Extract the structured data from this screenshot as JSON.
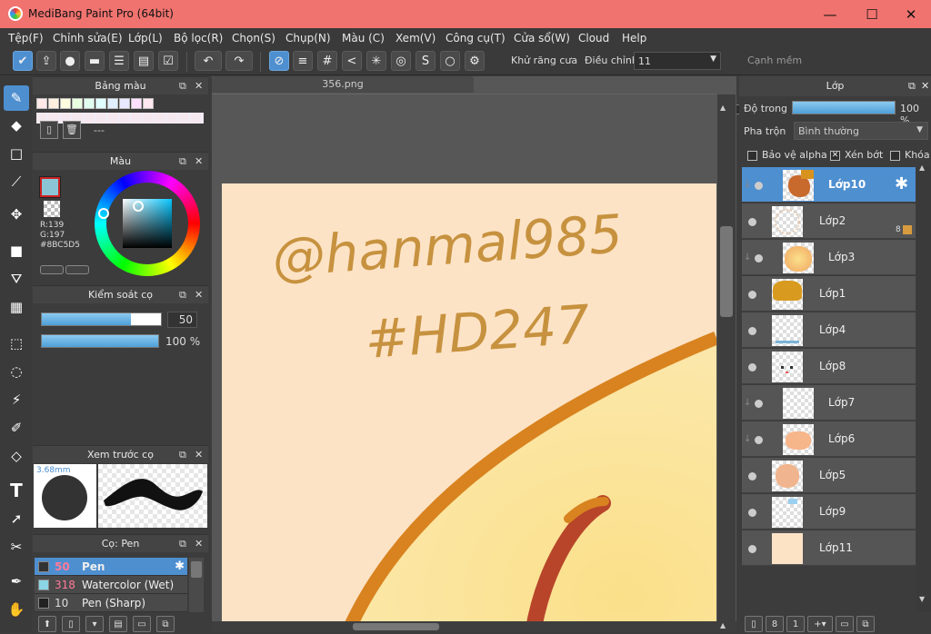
{
  "window": {
    "title": "MediBang Paint Pro (64bit)",
    "minimize": "—",
    "maximize": "☐",
    "close": "✕"
  },
  "menu": [
    "Tệp(F)",
    "Chỉnh sửa(E)",
    "Lớp(L)",
    "Bộ lọc(R)",
    "Chọn(S)",
    "Chụp(N)",
    "Màu (C)",
    "Xem(V)",
    "Công cụ(T)",
    "Cửa sổ(W)",
    "Cloud",
    "Help"
  ],
  "toolbar": {
    "antialias_label": "Khử răng cưa",
    "antialias_checked": true,
    "adjust_label": "Điều chỉnh",
    "adjust_value": "11",
    "smooth_edge_label": "Cạnh mềm",
    "smooth_edge_checked": false
  },
  "palette_panel": {
    "title": "Bảng màu",
    "name": "---",
    "swatches": [
      "#ffe9e9",
      "#fff0e0",
      "#ffffe0",
      "#e8ffe0",
      "#e0fff0",
      "#e0ffff",
      "#e0f0ff",
      "#e8e8ff",
      "#ffe0ff",
      "#ffe8f0"
    ]
  },
  "color_panel": {
    "title": "Màu",
    "r": "R:139",
    "g": "G:197",
    "hex": "#8BC5D5",
    "current_color": "#8BC5D5"
  },
  "brush_control": {
    "title": "Kiểm soát cọ",
    "size": "50",
    "size_fraction": 0.75,
    "opacity": "100 %",
    "opacity_fraction": 1.0
  },
  "brush_preview": {
    "title": "Xem trước cọ",
    "size_label": "3.68mm"
  },
  "brush_list": {
    "title": "Cọ: Pen",
    "items": [
      {
        "size": "50",
        "name": "Pen",
        "selected": true,
        "color": "#333333"
      },
      {
        "size": "318",
        "name": "Watercolor (Wet)",
        "selected": false,
        "color": "#8bd5e5"
      },
      {
        "size": "10",
        "name": "Pen (Sharp)",
        "selected": false,
        "color": "#222222"
      }
    ]
  },
  "canvas": {
    "tab": "356.png",
    "text1": "@hanmal985",
    "text2": "#HD247"
  },
  "layer_panel": {
    "title": "Lớp",
    "opacity_label": "Độ trong",
    "opacity_value": "100 %",
    "blend_label": "Pha trộn",
    "blend_value": "Bình thường",
    "protect_alpha": "Bảo vệ alpha",
    "clipping": "Xén bớt",
    "lock": "Khóa",
    "layers": [
      {
        "name": "Lớp10",
        "selected": true,
        "clipped": true,
        "badge": ""
      },
      {
        "name": "Lớp2",
        "selected": false,
        "clipped": false,
        "badge": "8"
      },
      {
        "name": "Lớp3",
        "selected": false,
        "clipped": true,
        "badge": ""
      },
      {
        "name": "Lớp1",
        "selected": false,
        "clipped": false,
        "badge": ""
      },
      {
        "name": "Lớp4",
        "selected": false,
        "clipped": false,
        "badge": ""
      },
      {
        "name": "Lớp8",
        "selected": false,
        "clipped": false,
        "badge": ""
      },
      {
        "name": "Lớp7",
        "selected": false,
        "clipped": true,
        "badge": ""
      },
      {
        "name": "Lớp6",
        "selected": false,
        "clipped": true,
        "badge": ""
      },
      {
        "name": "Lớp5",
        "selected": false,
        "clipped": false,
        "badge": ""
      },
      {
        "name": "Lớp9",
        "selected": false,
        "clipped": false,
        "badge": ""
      },
      {
        "name": "Lớp11",
        "selected": false,
        "clipped": false,
        "badge": ""
      }
    ]
  }
}
